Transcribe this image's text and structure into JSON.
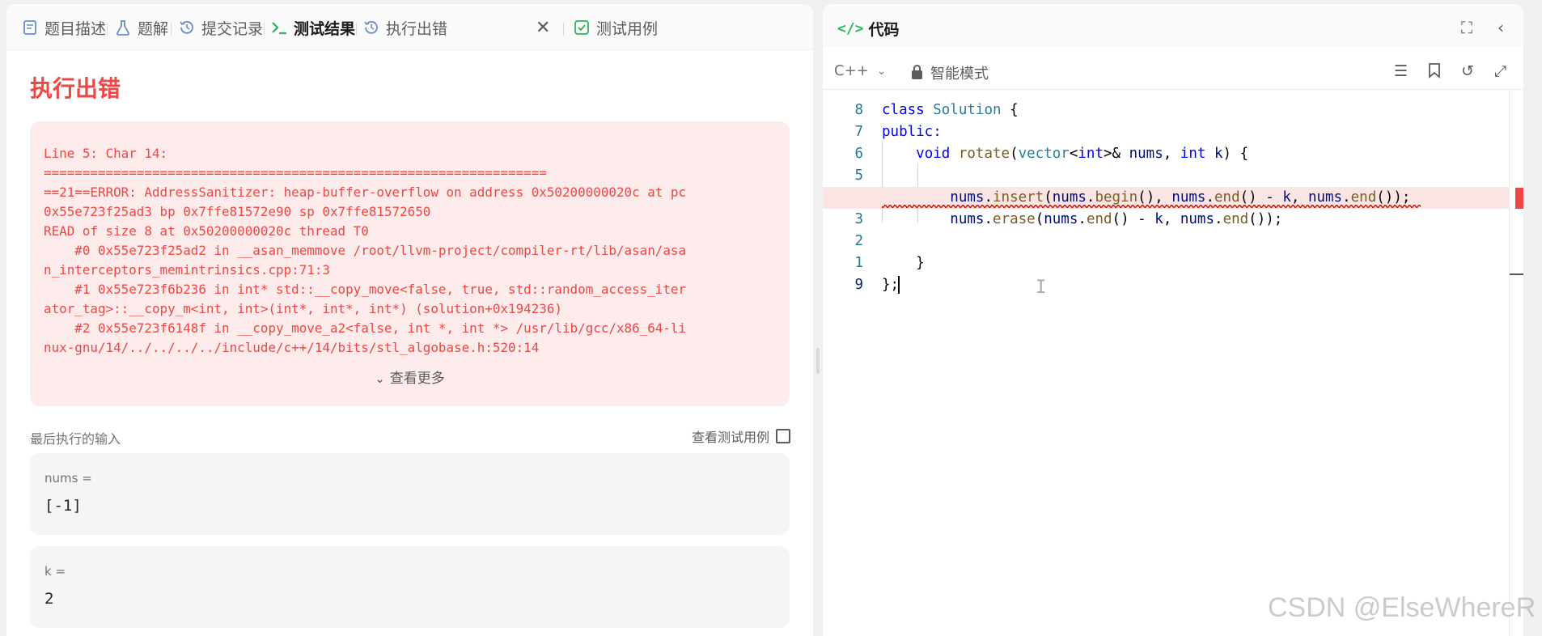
{
  "tabs": [
    {
      "label": "题目描述",
      "icon": "document-icon"
    },
    {
      "label": "题解",
      "icon": "flask-icon"
    },
    {
      "label": "提交记录",
      "icon": "history-icon"
    },
    {
      "label": "测试结果",
      "icon": "terminal-icon",
      "active": true
    },
    {
      "label": "执行出错",
      "icon": "history-icon",
      "closable": true
    },
    {
      "label": "测试用例",
      "icon": "checkbox-icon"
    }
  ],
  "error": {
    "title": "执行出错",
    "message": "Line 5: Char 14:\n=================================================================\n==21==ERROR: AddressSanitizer: heap-buffer-overflow on address 0x50200000020c at pc\n0x55e723f25ad3 bp 0x7ffe81572e90 sp 0x7ffe81572650\nREAD of size 8 at 0x50200000020c thread T0\n    #0 0x55e723f25ad2 in __asan_memmove /root/llvm-project/compiler-rt/lib/asan/asa\nn_interceptors_memintrinsics.cpp:71:3\n    #1 0x55e723f6b236 in int* std::__copy_move<false, true, std::random_access_iter\nator_tag>::__copy_m<int, int>(int*, int*, int*) (solution+0x194236)\n    #2 0x55e723f6148f in __copy_move_a2<false, int *, int *> /usr/lib/gcc/x86_64-li\nnux-gnu/14/../../../../include/c++/14/bits/stl_algobase.h:520:14",
    "see_more": "查看更多"
  },
  "last_input": {
    "label": "最后执行的输入",
    "view_cases": "查看测试用例",
    "params": [
      {
        "name": "nums =",
        "value": "[-1]"
      },
      {
        "name": "k =",
        "value": "2"
      }
    ]
  },
  "code_panel": {
    "title": "代码",
    "language": "C++",
    "mode": "智能模式",
    "line_numbers": [
      "8",
      "7",
      "6",
      "5",
      "",
      "3",
      "2",
      "1",
      "9"
    ]
  },
  "code_lines": {
    "l1": {
      "kw": "class",
      "ty": "Solution",
      "rest": " {"
    },
    "l2": {
      "kw": "public:"
    },
    "l3": {
      "kw1": "void",
      "fn": "rotate",
      "p1": "(",
      "ty": "vector",
      "p2": "<",
      "kw2": "int",
      "p3": ">& ",
      "v1": "nums",
      "p4": ", ",
      "kw3": "int",
      "p5": " ",
      "v2": "k",
      "p6": ") {"
    },
    "l5": {
      "v1": "nums",
      "p1": ".",
      "f1": "insert",
      "p2": "(",
      "v2": "nums",
      "p3": ".",
      "f2": "begin",
      "p4": "(), ",
      "v3": "nums",
      "p5": ".",
      "f3": "end",
      "p6": "() - ",
      "v4": "k",
      "p7": ", ",
      "v5": "nums",
      "p8": ".",
      "f4": "end",
      "p9": "());"
    },
    "l6": {
      "v1": "nums",
      "p1": ".",
      "f1": "erase",
      "p2": "(",
      "v2": "nums",
      "p3": ".",
      "f2": "end",
      "p4": "() - ",
      "v3": "k",
      "p5": ", ",
      "v4": "nums",
      "p6": ".",
      "f3": "end",
      "p7": "());"
    },
    "l8": {
      "text": "}"
    },
    "l9": {
      "text": "};"
    }
  },
  "watermark": "CSDN @ElseWhereR",
  "colors": {
    "error_red": "#ef4743",
    "error_bg": "#fdeceb",
    "accent_green": "#2db55d"
  }
}
